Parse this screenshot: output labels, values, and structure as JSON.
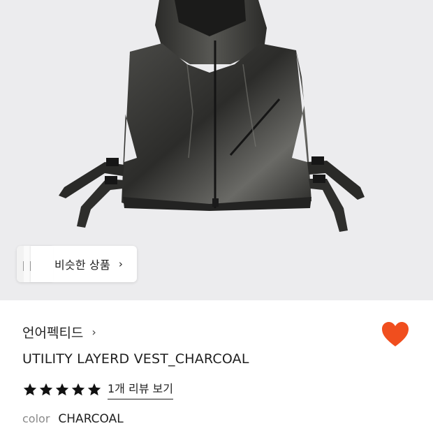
{
  "hero": {
    "image_subject": "black hooded utility vest with side buckle straps",
    "background_color": "#ececee"
  },
  "similar": {
    "label": "비슷한 상품",
    "chevron": "›"
  },
  "brand": {
    "name": "언어펙티드",
    "chevron": "›"
  },
  "product": {
    "title": "UTILITY LAYERD VEST_CHARCOAL"
  },
  "rating": {
    "stars": 5,
    "star_color": "#111111",
    "review_link": "1개 리뷰 보기"
  },
  "options": {
    "key": "color",
    "value": "CHARCOAL"
  },
  "wishlist": {
    "icon": "heart-icon",
    "color": "#f04e1e"
  }
}
